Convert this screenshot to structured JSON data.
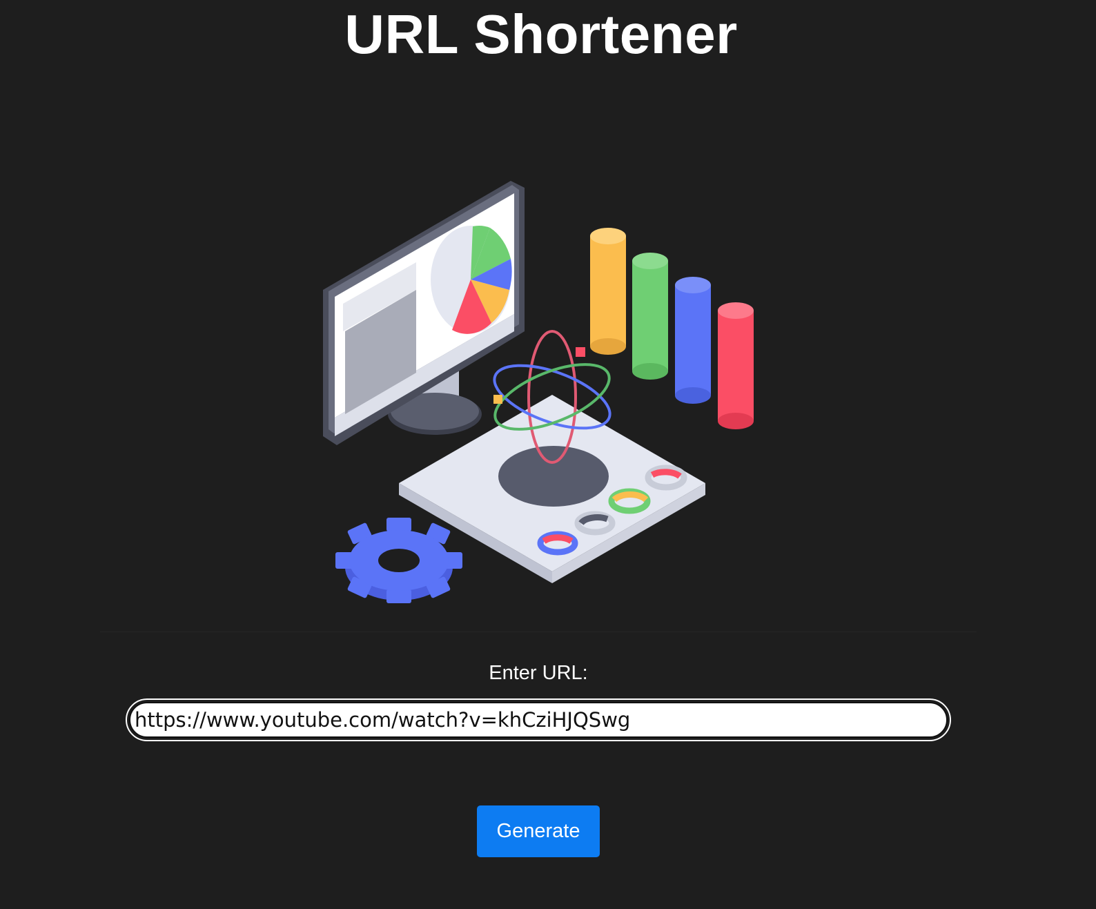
{
  "header": {
    "title": "URL Shortener"
  },
  "illustration": {
    "name": "analytics-illustration",
    "colors": {
      "yellow": "#fbbd4e",
      "green": "#6fcf73",
      "blue": "#5b74f7",
      "red": "#fb4e65",
      "panel": "#e4e7f1",
      "dark": "#55596b"
    }
  },
  "form": {
    "label": "Enter URL:",
    "url_value": "https://www.youtube.com/watch?v=khCziHJQSwg",
    "generate_label": "Generate"
  },
  "colors": {
    "background": "#1e1e1e",
    "accent": "#0d7cf2",
    "text": "#ffffff"
  }
}
